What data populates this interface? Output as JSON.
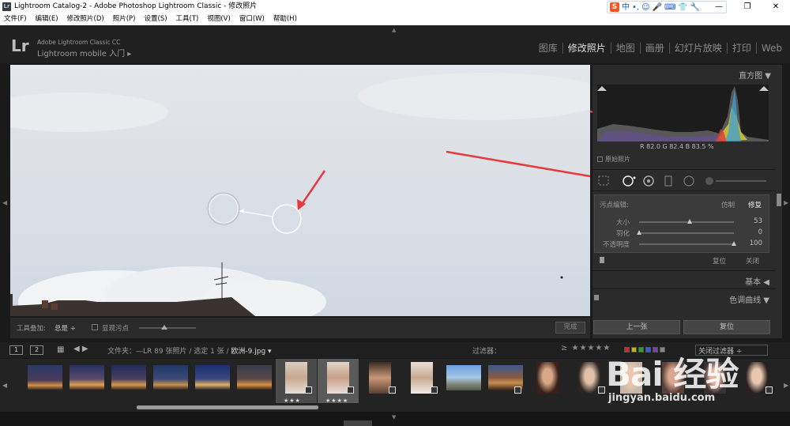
{
  "window": {
    "title": "Lightroom Catalog-2 - Adobe Photoshop Lightroom Classic - 修改照片",
    "controls": [
      "—",
      "❐",
      "✕"
    ]
  },
  "ime": {
    "logo": "S",
    "lang": "中",
    "punct": "•,",
    "icons": [
      "☺",
      "🎤",
      "⌨",
      "👕",
      "🔧"
    ]
  },
  "menu": [
    "文件(F)",
    "编辑(E)",
    "修改照片(D)",
    "照片(P)",
    "设置(S)",
    "工具(T)",
    "视图(V)",
    "窗口(W)",
    "帮助(H)"
  ],
  "header": {
    "logo": "Lr",
    "product": "Adobe Lightroom Classic CC",
    "mobile": "Lightroom mobile 入门 ▸",
    "modules": [
      "图库",
      "修改照片",
      "地图",
      "画册",
      "幻灯片放映",
      "打印",
      "Web"
    ],
    "active_module": "修改照片"
  },
  "toolbar": {
    "overlay_label": "工具叠加:",
    "overlay_value": "总是 ÷",
    "visualize_spots": "显现污点",
    "visualize_value": 0.45,
    "done": "完成"
  },
  "panel": {
    "histogram_title": "直方图 ▼",
    "rgb": {
      "r": "82.0",
      "g": "82.4",
      "b": "83.5",
      "unit": "%"
    },
    "original_photo": "原始照片",
    "spot_removal": {
      "label": "污点编辑:",
      "clone": "仿制",
      "heal": "修复",
      "sliders": [
        {
          "name": "大小",
          "value": "53",
          "level": 0.53
        },
        {
          "name": "羽化",
          "value": "0",
          "level": 0.0
        },
        {
          "name": "不透明度",
          "value": "100",
          "level": 1.0
        }
      ],
      "reset": "复位",
      "close": "关闭"
    },
    "sections": [
      "基本 ◀",
      "色调曲线 ▼"
    ],
    "prev_button": "上一张",
    "reset_button": "复位"
  },
  "filmstrip_bar": {
    "view1": "1",
    "view2": "2",
    "folder_label": "文件夹：",
    "info": "—LR   89 张照片 / 选定 1 张 / ",
    "filename": "欧洲-9.jpg ▾",
    "filter_label": "过滤器：",
    "stars": "≥ ★★★★★",
    "filter_off": "关闭过滤器 ÷"
  },
  "colors": {
    "arrow": "#e8393c",
    "label_colors": [
      "#c03030",
      "#c8b020",
      "#30a030",
      "#3060c8",
      "#8040a0",
      "#888888"
    ]
  },
  "watermark": {
    "logo": "Bai 经验",
    "url": "jingyan.baidu.com"
  }
}
